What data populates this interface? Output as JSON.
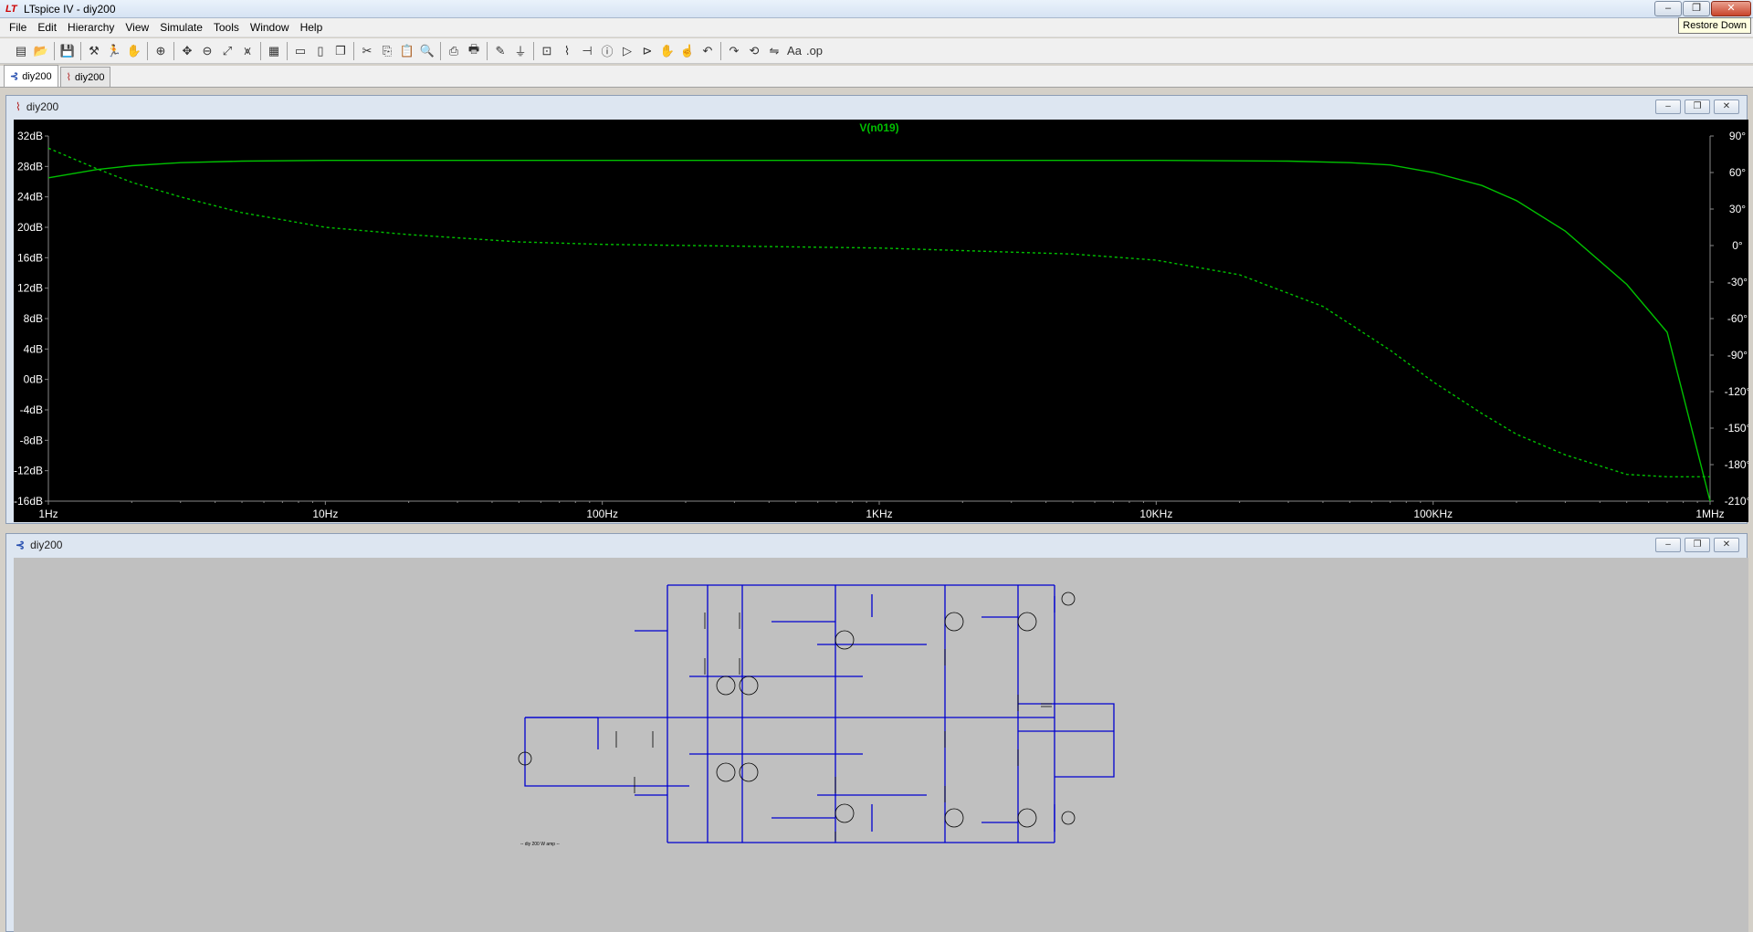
{
  "window": {
    "title": "LTspice IV - diy200",
    "logo": "LT",
    "tooltip": "Restore Down",
    "buttons": {
      "minimize": "–",
      "maximize": "❐",
      "close": "✕"
    }
  },
  "menu": [
    "File",
    "Edit",
    "Hierarchy",
    "View",
    "Simulate",
    "Tools",
    "Window",
    "Help"
  ],
  "toolbar_icons": [
    "new-schematic",
    "open",
    "save",
    "control-panel",
    "run",
    "halt",
    "zoom-in",
    "pan",
    "zoom-out",
    "zoom-fit",
    "autorange",
    "plot-settings",
    "tile-horizontal",
    "tile-vertical",
    "cascade",
    "cut",
    "copy",
    "paste",
    "find",
    "print-setup",
    "print",
    "wire",
    "ground",
    "label-net",
    "resistor",
    "capacitor",
    "inductor",
    "diode",
    "component",
    "move",
    "drag",
    "undo",
    "redo",
    "rotate",
    "mirror",
    "text",
    "spice-directive"
  ],
  "tabs": [
    {
      "label": "diy200",
      "icon": "schematic-icon",
      "active": true
    },
    {
      "label": "diy200",
      "icon": "waveform-icon",
      "active": false
    }
  ],
  "plot_window": {
    "title": "diy200"
  },
  "schematic_window": {
    "title": "diy200",
    "note": "-- diy 200 W amp --"
  },
  "chart_data": {
    "type": "line",
    "title": "V(n019)",
    "xscale": "log",
    "xlim": [
      1,
      1000000
    ],
    "xticks": [
      "1Hz",
      "10Hz",
      "100Hz",
      "1KHz",
      "10KHz",
      "100KHz",
      "1MHz"
    ],
    "ylim": [
      -16,
      32
    ],
    "yticks": [
      "32dB",
      "28dB",
      "24dB",
      "20dB",
      "16dB",
      "12dB",
      "8dB",
      "4dB",
      "0dB",
      "-4dB",
      "-8dB",
      "-12dB",
      "-16dB"
    ],
    "y2lim": [
      -210,
      90
    ],
    "y2ticks": [
      "90°",
      "60°",
      "30°",
      "0°",
      "-30°",
      "-60°",
      "-90°",
      "-120°",
      "-150°",
      "-180°",
      "-210°"
    ],
    "color": "#00c000",
    "series": [
      {
        "name": "V(n019)",
        "kind": "magnitude",
        "axis": "left",
        "x": [
          1,
          1.5,
          2,
          3,
          5,
          10,
          20,
          50,
          100,
          1000,
          10000,
          30000,
          50000,
          70000,
          100000,
          150000,
          200000,
          300000,
          500000,
          700000,
          1000000
        ],
        "y": [
          26.5,
          27.6,
          28.1,
          28.5,
          28.7,
          28.8,
          28.8,
          28.8,
          28.8,
          28.8,
          28.8,
          28.7,
          28.5,
          28.2,
          27.2,
          25.5,
          23.5,
          19.5,
          12.5,
          6.2,
          -16
        ]
      },
      {
        "name": "V(n019) phase",
        "kind": "phase",
        "axis": "right",
        "x": [
          1,
          1.5,
          2,
          3,
          5,
          10,
          20,
          50,
          100,
          1000,
          5000,
          10000,
          20000,
          40000,
          70000,
          100000,
          150000,
          200000,
          300000,
          500000,
          700000,
          1000000
        ],
        "y": [
          80,
          63,
          52,
          40,
          27,
          15,
          9,
          3,
          1,
          -2,
          -7,
          -12,
          -24,
          -50,
          -86,
          -112,
          -138,
          -155,
          -172,
          -188,
          -190,
          -190
        ]
      }
    ]
  }
}
